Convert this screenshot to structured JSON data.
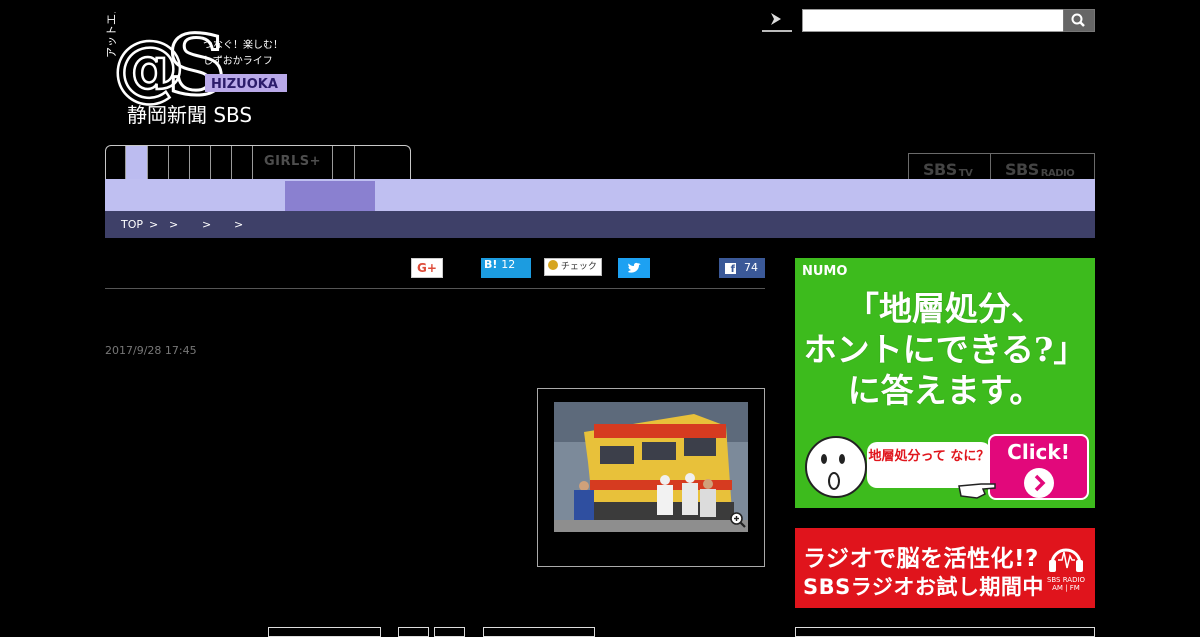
{
  "header": {
    "logo_text": "アットエス @S つなぐ！楽しむ！しずおかライフ SHIZUOKA 静岡新聞 SBS",
    "search": {
      "placeholder": "",
      "value": ""
    }
  },
  "tabs": {
    "items": [
      "",
      "",
      "",
      "",
      "",
      "",
      "",
      "GIRLS+",
      "",
      ""
    ],
    "active_index": 1
  },
  "media_links": [
    {
      "label": "SBS",
      "suffix": "TV"
    },
    {
      "label": "SBS",
      "suffix": "RADIO"
    }
  ],
  "breadcrumb": {
    "home": "TOP",
    "separator": ">"
  },
  "social": {
    "gplus": "G+",
    "hatena": {
      "label": "B!",
      "count": "12"
    },
    "mixi": "チェック",
    "facebook_count": "74"
  },
  "article": {
    "date": "2017/9/28 17:45"
  },
  "ads": {
    "numo": {
      "brand": "NUMO",
      "headline_1": "「地層処分、",
      "headline_2": "ホントにできる?」",
      "headline_3": "に答えます。",
      "bubble": "地層処分って なに？",
      "cta": "Click!"
    },
    "radio": {
      "line1": "ラジオで脳を活性化!?",
      "line2": "SBSラジオお試し期間中",
      "logo": "SBS RADIO",
      "logo_sub": "AM | FM"
    }
  },
  "colors": {
    "subnav": "#bfbff1",
    "subnav_active": "#8a80d0",
    "breadcrumb_bg": "#3e4068",
    "numo_bg": "#3dbb1d",
    "radio_bg": "#e0141c"
  }
}
